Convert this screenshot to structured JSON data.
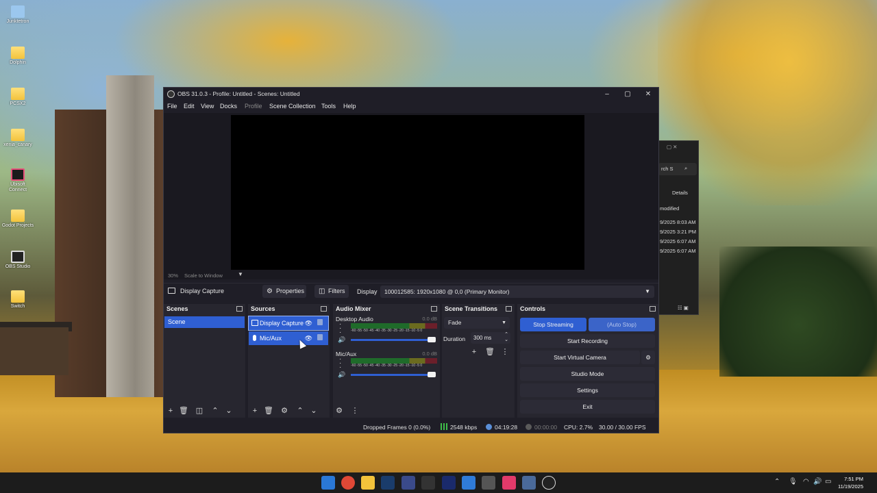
{
  "desktop": {
    "icons": [
      {
        "label": "Junktetron",
        "type": "recycle"
      },
      {
        "label": "Dolphin",
        "type": "folder"
      },
      {
        "label": "PCSX2",
        "type": "folder"
      },
      {
        "label": "xenia_canary",
        "type": "folder"
      },
      {
        "label": "Ubisoft Connect",
        "type": "ubi"
      },
      {
        "label": "Godot Projects",
        "type": "folder"
      },
      {
        "label": "OBS Studio",
        "type": "obs"
      },
      {
        "label": "Switch",
        "type": "folder"
      }
    ]
  },
  "bg_window": {
    "search": "rch S",
    "details": "Details",
    "modified": "modified",
    "dates": [
      "9/2025 8:03 AM",
      "9/2025 3:21 PM",
      "9/2025 6:07 AM",
      "9/2025 6:07 AM"
    ]
  },
  "obs": {
    "title": "OBS 31.0.3 - Profile: Untitled - Scenes: Untitled",
    "menu": {
      "file": "File",
      "edit": "Edit",
      "view": "View",
      "docks": "Docks",
      "profile": "Profile",
      "scene_collection": "Scene Collection",
      "tools": "Tools",
      "help": "Help"
    },
    "preview": {
      "zoom": "30%",
      "scale": "Scale to Window"
    },
    "context": {
      "source": "Display Capture",
      "properties": "Properties",
      "filters": "Filters",
      "display_label": "Display",
      "display_value": "100012585: 1920x1080 @ 0,0 (Primary Monitor)"
    },
    "scenes": {
      "header": "Scenes",
      "items": [
        "Scene"
      ]
    },
    "sources": {
      "header": "Sources",
      "items": [
        "Display Capture",
        "Mic/Aux"
      ]
    },
    "mixer": {
      "header": "Audio Mixer",
      "channels": [
        {
          "name": "Desktop Audio",
          "db": "0.0 dB"
        },
        {
          "name": "Mic/Aux",
          "db": "0.0 dB"
        }
      ],
      "ticks": "-60 -55 -50 -45 -40 -35 -30 -25 -20 -15 -10 -5 0"
    },
    "transitions": {
      "header": "Scene Transitions",
      "selected": "Fade",
      "duration_label": "Duration",
      "duration": "300 ms"
    },
    "controls": {
      "header": "Controls",
      "stop_streaming": "Stop Streaming",
      "auto_stop": "(Auto Stop)",
      "start_recording": "Start Recording",
      "start_virtual_camera": "Start Virtual Camera",
      "studio_mode": "Studio Mode",
      "settings": "Settings",
      "exit": "Exit"
    },
    "status": {
      "dropped": "Dropped Frames 0 (0.0%)",
      "bitrate": "2548 kbps",
      "stream_time": "04:19:28",
      "rec_time": "00:00:00",
      "cpu": "CPU: 2.7%",
      "fps": "30.00 / 30.00 FPS"
    }
  },
  "taskbar": {
    "time": "7:51 PM",
    "date": "11/19/2025"
  }
}
